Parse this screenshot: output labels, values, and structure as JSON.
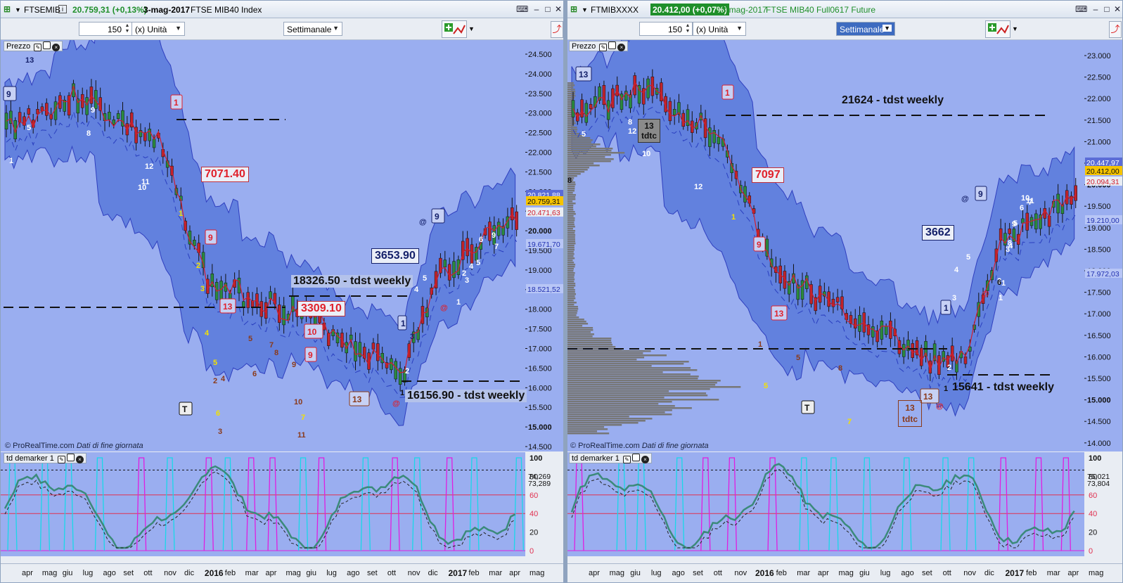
{
  "left": {
    "title": {
      "symbol": "FTSEMIB",
      "price": "20.759,31 (+0,13%)",
      "date": "3-mag-2017",
      "name": "FTSE MIB40 Index"
    },
    "toolbar": {
      "bars": "150",
      "units": "(x) Unità",
      "period": "Settimanale"
    },
    "price_panel_label": "Prezzo",
    "indicator_label": "td demarker 1",
    "credit_site": "© ProRealTime.com",
    "credit_note": "Dati di fine giornata",
    "annotations": {
      "box1": "7071.40",
      "box2": "3309.10",
      "box3": "3653.90",
      "tdst_high": "18326.50 - tdst weekly",
      "tdst_low": "16156.90 - tdst weekly"
    },
    "price_axis": [
      "24.500",
      "24.000",
      "23.500",
      "23.000",
      "22.500",
      "22.000",
      "21.500",
      "21.000",
      "20.500",
      "20.000",
      "19.500",
      "19.000",
      "18.500",
      "18.000",
      "17.500",
      "17.000",
      "16.500",
      "16.000",
      "15.500",
      "15.000",
      "14.500"
    ],
    "price_tags": {
      "upper": "20.821,88",
      "last": "20.759,31",
      "lower": "20.471,63",
      "mid": "19.671,70",
      "low": "18.521,52"
    },
    "ind_axis": [
      "100",
      "80",
      "60",
      "40",
      "20",
      "0"
    ],
    "ind_tags": {
      "a": "74,269",
      "b": "73,289"
    },
    "months": [
      "apr",
      "mag",
      "giu",
      "lug",
      "ago",
      "set",
      "ott",
      "nov",
      "dic",
      "2016",
      "feb",
      "mar",
      "apr",
      "mag",
      "giu",
      "lug",
      "ago",
      "set",
      "ott",
      "nov",
      "dic",
      "2017",
      "feb",
      "mar",
      "apr",
      "mag"
    ]
  },
  "right": {
    "title": {
      "symbol": "FTMIBXXXX",
      "price": "20.412,00 (+0,07%)",
      "date": "3-mag-2017",
      "name": "FTSE MIB40 Full0617 Future"
    },
    "toolbar": {
      "bars": "150",
      "units": "(x) Unità",
      "period": "Settimanale"
    },
    "price_panel_label": "Prezzo",
    "indicator_label": "td demarker 1",
    "credit_site": "© ProRealTime.com",
    "credit_note": "Dati di fine giornata",
    "annotations": {
      "box1": "7097",
      "box2": "3662",
      "tdst_high": "21624 - tdst weekly",
      "tdst_low": "15641 - tdst weekly",
      "tdtc1": "13",
      "tdtc1b": "tdtc",
      "tdtc2": "13",
      "tdtc2b": "tdtc"
    },
    "price_axis": [
      "23.000",
      "22.500",
      "22.000",
      "21.500",
      "21.000",
      "20.500",
      "20.000",
      "19.500",
      "19.000",
      "18.500",
      "18.000",
      "17.500",
      "17.000",
      "16.500",
      "16.000",
      "15.500",
      "15.000",
      "14.500",
      "14.000"
    ],
    "price_tags": {
      "upper": "20.447,97",
      "last": "20.412,00",
      "lower": "20.094,31",
      "mid": "19.210,00",
      "low": "17.972,03"
    },
    "ind_axis": [
      "100",
      "80",
      "60",
      "40",
      "20",
      "0"
    ],
    "ind_tags": {
      "a": "75,021",
      "b": "73,804"
    },
    "months": [
      "apr",
      "mag",
      "giu",
      "lug",
      "ago",
      "set",
      "ott",
      "nov",
      "2016",
      "feb",
      "mar",
      "apr",
      "mag",
      "giu",
      "lug",
      "ago",
      "set",
      "ott",
      "nov",
      "dic",
      "2017",
      "feb",
      "mar",
      "apr",
      "mag"
    ]
  },
  "colors": {
    "chart_bg": "#9aaef0",
    "band": "#4f72d8",
    "up": "#2b8a3e",
    "down": "#c0232b",
    "ma": "#d21e2e",
    "volume_profile": "#777777",
    "ind_osc": "#3b8a7a",
    "ind_magenta": "#e01ee0",
    "ind_cyan": "#19d8e8"
  }
}
